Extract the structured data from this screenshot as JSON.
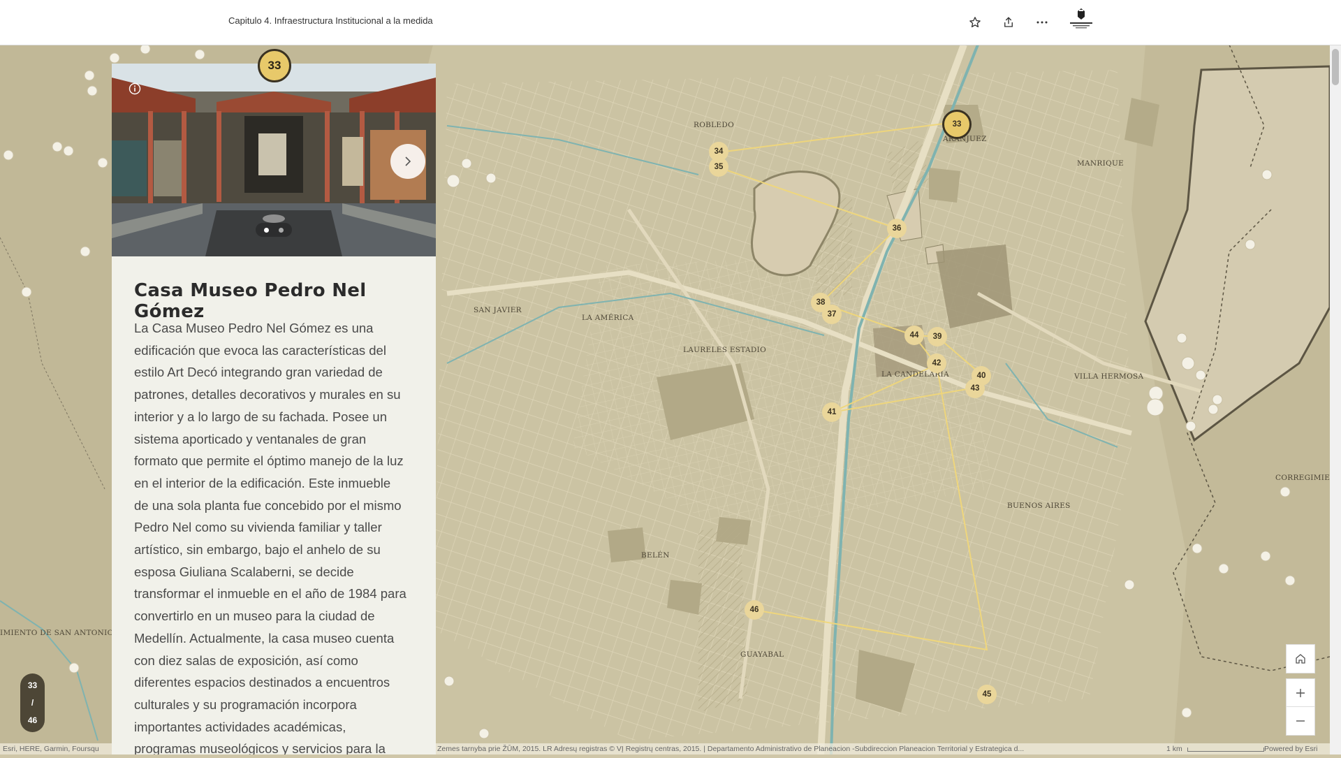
{
  "header": {
    "title": "Capitulo 4. Infraestructura Institucional a la medida",
    "buttons": [
      "star-icon",
      "share-icon",
      "more-icon"
    ]
  },
  "panel": {
    "badge": "33",
    "title": "Casa Museo Pedro Nel Gómez",
    "body": "La Casa Museo Pedro Nel Gómez es una\nedificación que evoca las características del\nestilo Art Decó integrando gran variedad de\npatrones, detalles decorativos y murales en su\ninterior y a lo largo de su fachada. Posee un\nsistema aporticado y ventanales de gran\nformato que permite el óptimo manejo de la luz\nen el interior de la edificación.  Este inmueble\nde una sola planta fue concebido por el mismo\nPedro Nel como su vivienda familiar y taller\nartístico, sin embargo, bajo el anhelo de su\nesposa Giuliana Scalaberni, se decide\ntransformar el inmueble en el año de 1984 para\nconvertirlo en un museo para la ciudad de\nMedellín.  Actualmente, la casa museo cuenta\ncon diez salas de exposición, así como\ndiferentes espacios destinados a encuentros\nculturales y su programación incorpora\nimportantes actividades académicas,\nprogramas museológicos y servicios para la",
    "carousel": {
      "slides": 2,
      "active": 1
    }
  },
  "counter": {
    "current": "33",
    "sep": "/",
    "total": "46"
  },
  "map": {
    "colors": {
      "base": "#cdc5a5",
      "water": "#7fb3b0",
      "road": "#e4dcc0",
      "park": "#a89f7e",
      "route": "#f0d77a",
      "marker": "#e8c96a"
    },
    "place_labels": [
      {
        "text": "ROBLEDO"
      },
      {
        "text": "ARANJUEZ"
      },
      {
        "text": "MANRIQUE"
      },
      {
        "text": "SAN JAVIER"
      },
      {
        "text": "LA AMÉRICA"
      },
      {
        "text": "LAURELES ESTADIO"
      },
      {
        "text": "LA CANDELARIA"
      },
      {
        "text": "VILLA HERMOSA"
      },
      {
        "text": "BUENOS AIRES"
      },
      {
        "text": "BELÉN"
      },
      {
        "text": "GUAYABAL"
      },
      {
        "text": "CORREGIMIENTO"
      },
      {
        "text": "IMIENTO DE SAN ANTONIO DE P"
      }
    ],
    "markers": [
      "33",
      "34",
      "35",
      "36",
      "38",
      "37",
      "44",
      "39",
      "42",
      "40",
      "43",
      "41",
      "46",
      "45"
    ],
    "controls": {
      "home": "home-icon",
      "zoom_in": "plus-icon",
      "zoom_out": "minus-icon"
    }
  },
  "attribution": {
    "left": "Esri, HERE, Garmin, Foursqu",
    "middle": "Zemes tarnyba prie ŽŪM, 2015. LR Adresų registras © VĮ Registrų centras, 2015. | Departamento Administrativo de Planeacion -Subdireccion Planeacion Territorial y Estrategica d...",
    "scale": "1 km",
    "powered": "Powered by Esri"
  }
}
